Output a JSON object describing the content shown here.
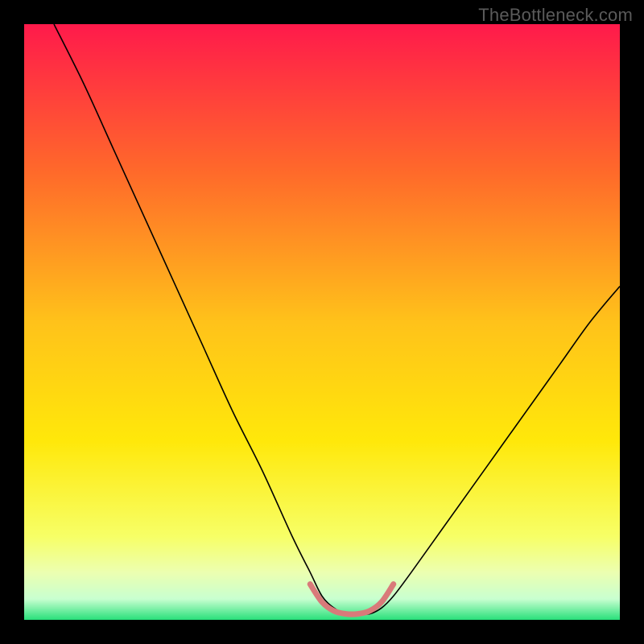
{
  "watermark": {
    "text": "TheBottleneck.com"
  },
  "chart_data": {
    "type": "line",
    "title": "",
    "xlabel": "",
    "ylabel": "",
    "xlim": [
      0,
      100
    ],
    "ylim": [
      0,
      100
    ],
    "grid": false,
    "legend": false,
    "background_gradient": {
      "type": "vertical",
      "stops": [
        {
          "pos": 0.0,
          "color": "#ff1a4b"
        },
        {
          "pos": 0.25,
          "color": "#ff6a2a"
        },
        {
          "pos": 0.5,
          "color": "#ffc21a"
        },
        {
          "pos": 0.7,
          "color": "#ffe80a"
        },
        {
          "pos": 0.86,
          "color": "#f7ff66"
        },
        {
          "pos": 0.92,
          "color": "#ecffb0"
        },
        {
          "pos": 0.965,
          "color": "#c8ffd0"
        },
        {
          "pos": 1.0,
          "color": "#28e07a"
        }
      ]
    },
    "series": [
      {
        "name": "bottleneck-curve",
        "color": "#000000",
        "width": 1.6,
        "x": [
          5,
          10,
          15,
          20,
          25,
          30,
          35,
          40,
          45,
          48,
          50,
          52,
          54,
          56,
          58,
          60,
          62,
          65,
          70,
          75,
          80,
          85,
          90,
          95,
          100
        ],
        "y": [
          100,
          90,
          79,
          68,
          57,
          46,
          35,
          25,
          14,
          8,
          4,
          2,
          1,
          1,
          1,
          2,
          4,
          8,
          15,
          22,
          29,
          36,
          43,
          50,
          56
        ]
      },
      {
        "name": "flat-bottom-marker",
        "color": "#d97a7a",
        "width": 7,
        "linecap": "round",
        "x": [
          48,
          50,
          52,
          54,
          56,
          58,
          60,
          62
        ],
        "y": [
          6,
          3,
          1.5,
          1,
          1,
          1.5,
          3,
          6
        ]
      }
    ]
  }
}
